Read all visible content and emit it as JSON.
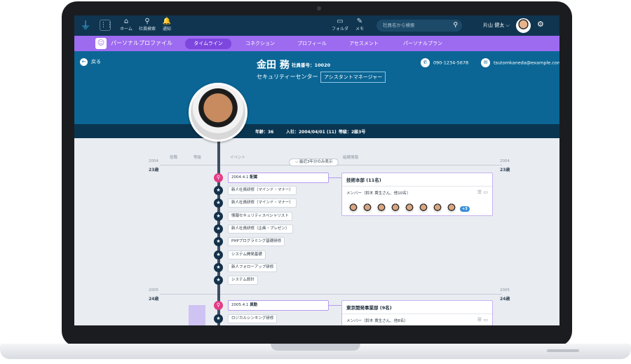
{
  "topbar": {
    "nav": [
      {
        "icon": "home-icon",
        "glyph": "⌂",
        "label": "ホーム"
      },
      {
        "icon": "search-icon",
        "glyph": "⚲",
        "label": "社員検索"
      },
      {
        "icon": "bell-icon",
        "glyph": "🔔",
        "label": "通知"
      },
      {
        "icon": "folder-icon",
        "glyph": "▭",
        "label": "フォルダ"
      },
      {
        "icon": "memo-icon",
        "glyph": "✎",
        "label": "メモ"
      }
    ],
    "search_placeholder": "社員名から検索",
    "user_name": "片山 健太 ⌵"
  },
  "profile_bar": {
    "title": "パーソナルプロファイル",
    "tabs": [
      {
        "label": "タイムライン",
        "active": true
      },
      {
        "label": "コネクション",
        "active": false
      },
      {
        "label": "プロフィール",
        "active": false
      },
      {
        "label": "アセスメント",
        "active": false
      },
      {
        "label": "パーソナルプラン",
        "active": false
      }
    ]
  },
  "header": {
    "back_label": "戻る",
    "phone": "090-1234-5678",
    "email": "tsutomkaneda@example.com",
    "name": "金田 務",
    "employee_no": "社員番号：10020",
    "department": "セキュリティーセンター",
    "role": "アシスタントマネージャー",
    "age": "年齢：36",
    "join_date": "入社：2004/04/01 (11)",
    "grade": "等級：2級3号"
  },
  "timeline": {
    "columns": [
      "役職",
      "等級",
      "イベント",
      "組織情報"
    ],
    "filter_label": "最近3年分のみ表示",
    "years": [
      {
        "year": "2004",
        "age": "23歳"
      },
      {
        "year": "2005",
        "age": "24歳"
      }
    ],
    "major_events": [
      {
        "date": "2004.4.1",
        "type": "配属"
      },
      {
        "date": "2005.4.1",
        "type": "異動"
      }
    ],
    "events_2004": [
      "新人社員研修（マインド・マナー）",
      "新人社員研修（マインド・マナー）",
      "情報セキュリティスペシャリスト",
      "新人社員研修（企画・プレゼン）",
      "PHPプログラミング基礎研修",
      "システム開発基礎",
      "新人フォローアップ研修",
      "システム設計"
    ],
    "events_2005": [
      "ロジカルシンキング研修"
    ],
    "cards": [
      {
        "title": "技術本部 (11名)",
        "members": "メンバー（鈴木 貴生さん、他10名）",
        "more": "+3"
      },
      {
        "title": "東京開発事業部 (9名)",
        "members": "メンバー（鈴木 貴生さん、他8名）"
      }
    ]
  }
}
